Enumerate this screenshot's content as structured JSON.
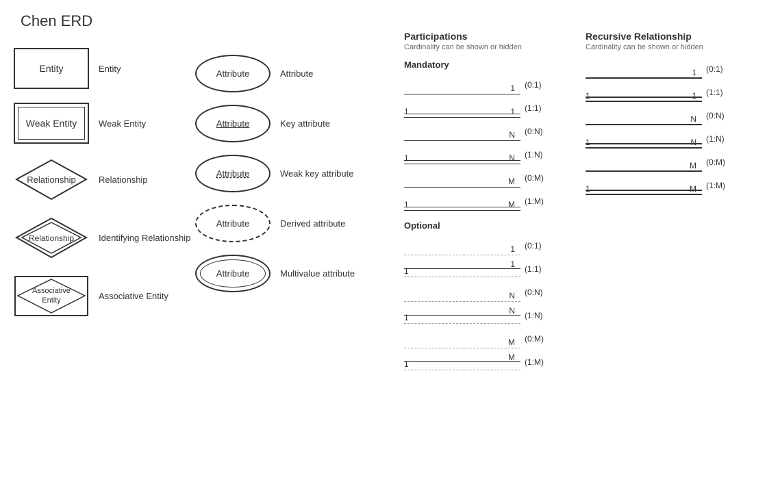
{
  "title": "Chen ERD",
  "shapes": {
    "entity": {
      "label": "Entity",
      "name": "Entity"
    },
    "weakEntity": {
      "label": "Weak Entity",
      "name": "Weak Entity"
    },
    "relationship": {
      "label": "Relationship",
      "name": "Relationship"
    },
    "identifyingRelationship": {
      "label": "Identifying Relationship",
      "name": "Relationship"
    },
    "associativeEntity": {
      "label": "Associative Entity",
      "name": "Associative\nEntity"
    }
  },
  "attributes": {
    "attribute": {
      "label": "Attribute",
      "name": "Attribute"
    },
    "keyAttribute": {
      "label": "Key attribute",
      "name": "Attribute"
    },
    "weakKeyAttribute": {
      "label": "Weak key attribute",
      "name": "Attribute"
    },
    "derivedAttribute": {
      "label": "Derived attribute",
      "name": "Attribute"
    },
    "multivalueAttribute": {
      "label": "Multivalue attribute",
      "name": "Attribute"
    }
  },
  "participations": {
    "title": "Participations",
    "subtitle": "Cardinality can be shown or hidden",
    "mandatory": {
      "title": "Mandatory",
      "rows": [
        {
          "left": "",
          "right": "1",
          "label": "(0:1)"
        },
        {
          "left": "1",
          "right": "1",
          "label": "(1:1)"
        },
        {
          "left": "",
          "right": "N",
          "label": "(0:N)"
        },
        {
          "left": "1",
          "right": "N",
          "label": "(1:N)"
        },
        {
          "left": "",
          "right": "M",
          "label": "(0:M)"
        },
        {
          "left": "1",
          "right": "M",
          "label": "(1:M)"
        }
      ]
    },
    "optional": {
      "title": "Optional",
      "rows": [
        {
          "left": "",
          "right": "1",
          "label": "(0:1)"
        },
        {
          "left": "1",
          "right": "1",
          "label": "(1:1)"
        },
        {
          "left": "",
          "right": "N",
          "label": "(0:N)"
        },
        {
          "left": "1",
          "right": "N",
          "label": "(1:N)"
        },
        {
          "left": "",
          "right": "M",
          "label": "(0:M)"
        },
        {
          "left": "1",
          "right": "M",
          "label": "(1:M)"
        }
      ]
    }
  },
  "recursive": {
    "title": "Recursive Relationship",
    "subtitle": "Cardinality can be shown or hidden",
    "rows": [
      {
        "left": "",
        "right": "1",
        "label": "(0:1)"
      },
      {
        "left": "1",
        "right": "1",
        "label": "(1:1)"
      },
      {
        "left": "",
        "right": "N",
        "label": "(0:N)"
      },
      {
        "left": "1",
        "right": "N",
        "label": "(1:N)"
      },
      {
        "left": "",
        "right": "M",
        "label": "(0:M)"
      },
      {
        "left": "1",
        "right": "M",
        "label": "(1:M)"
      }
    ]
  }
}
